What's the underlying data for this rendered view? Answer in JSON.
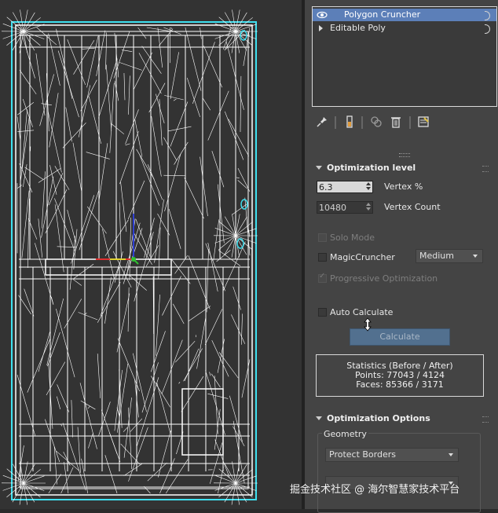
{
  "modifier_stack": {
    "items": [
      {
        "label": "Polygon Cruncher",
        "selected": true,
        "icon": "eye-icon"
      },
      {
        "label": "Editable Poly",
        "selected": false,
        "icon": "expand-triangle-icon"
      }
    ]
  },
  "toolbar": {
    "icons": [
      "pin-stack-icon",
      "show-end-result-icon",
      "make-unique-icon",
      "remove-modifier-icon",
      "configure-modifier-sets-icon"
    ]
  },
  "optimization_level": {
    "title": "Optimization level",
    "vertex_percent": {
      "value": "6.3",
      "label": "Vertex %"
    },
    "vertex_count": {
      "value": "10480",
      "label": "Vertex Count"
    },
    "solo_mode": {
      "label": "Solo Mode",
      "checked": false,
      "enabled": false
    },
    "magic_cruncher": {
      "label": "MagicCruncher",
      "checked": false,
      "enabled": true,
      "option": "Medium"
    },
    "progressive_optimization": {
      "label": "Progressive Optimization",
      "checked": true,
      "enabled": false
    },
    "auto_calculate": {
      "label": "Auto Calculate",
      "checked": false
    },
    "calculate_button": "Calculate",
    "stats": {
      "title": "Statistics (Before / After)",
      "points": "Points: 77043 / 4124",
      "faces": "Faces: 85366 / 3171"
    }
  },
  "optimization_options": {
    "title": "Optimization Options",
    "group_title": "Geometry",
    "protect_borders": "Protect Borders"
  },
  "watermark": "掘金技术社区 @ 海尔智慧家技术平台",
  "colors": {
    "viewport_bg": "#333333",
    "panel_bg": "#444444",
    "selection": "#5c7fb8",
    "wire": "#ffffff",
    "outline": "#3ee0f0"
  }
}
